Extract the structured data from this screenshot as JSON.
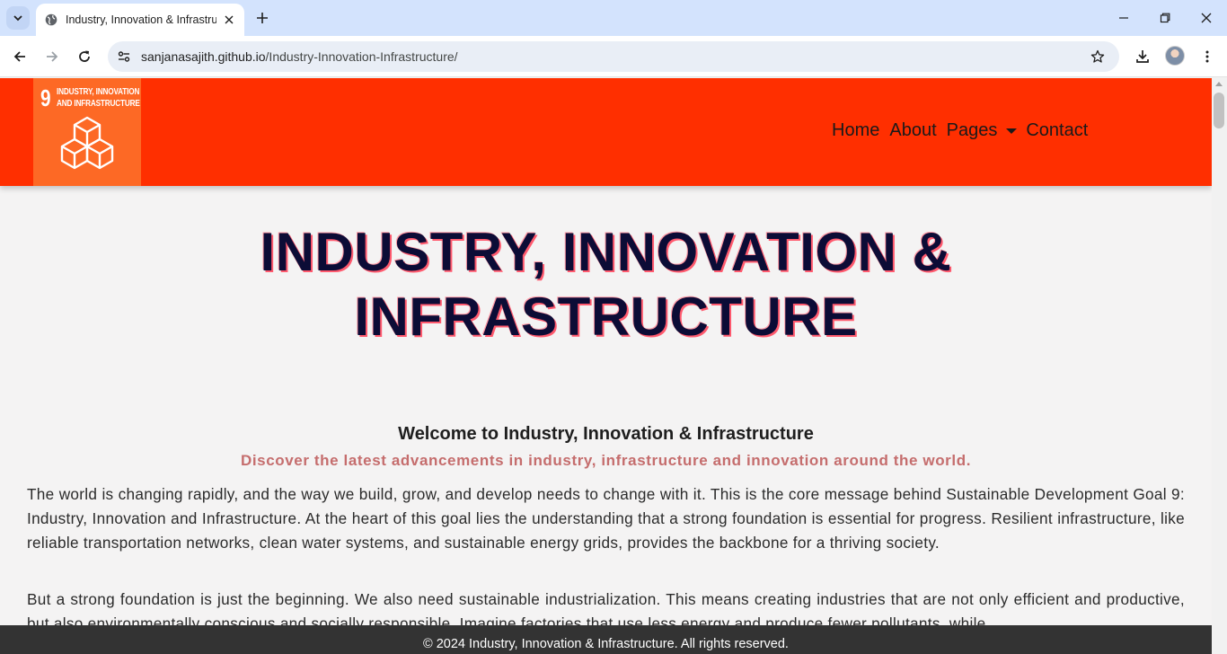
{
  "browser": {
    "tab_title": "Industry, Innovation & Infrastructure",
    "url_host": "sanjanasajith.github.io",
    "url_path": "/Industry-Innovation-Infrastructure/"
  },
  "site": {
    "logo": {
      "number": "9",
      "line1": "INDUSTRY, INNOVATION",
      "line2": "AND INFRASTRUCTURE",
      "icon": "stacked-cubes-icon"
    },
    "nav": {
      "home": "Home",
      "about": "About",
      "pages": "Pages",
      "contact": "Contact"
    },
    "hero": {
      "line1": "INDUSTRY, INNOVATION &",
      "line2": "INFRASTRUCTURE"
    },
    "welcome": "Welcome to Industry, Innovation & Infrastructure",
    "discover": "Discover the latest advancements in industry, infrastructure and innovation around the world.",
    "paragraphs": [
      "The world is changing rapidly, and the way we build, grow, and develop needs to change with it. This is the core message behind Sustainable Development Goal 9: Industry, Innovation and Infrastructure. At the heart of this goal lies the understanding that a strong foundation is essential for progress. Resilient infrastructure, like reliable transportation networks, clean water systems, and sustainable energy grids, provides the backbone for a thriving society.",
      "But a strong foundation is just the beginning. We also need sustainable industrialization. This means creating industries that are not only efficient and productive, but also environmentally conscious and socially responsible. Imagine factories that use less energy and produce fewer pollutants, while"
    ],
    "footer": "© 2024 Industry, Innovation & Infrastructure. All rights reserved."
  },
  "colors": {
    "header_bg": "#ff2f00",
    "logo_bg": "#fd6925",
    "hero_text": "#0c0c36",
    "discover_text": "#c56d6d",
    "footer_bg": "#333333"
  }
}
